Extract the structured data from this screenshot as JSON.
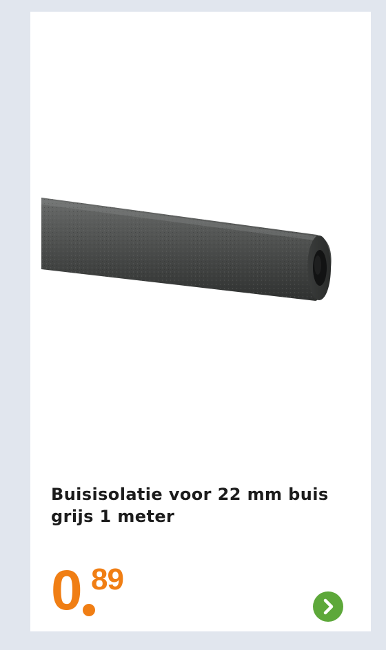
{
  "product": {
    "title": "Buisisolatie voor 22 mm buis grijs 1 meter",
    "image_icon": "pipe-insulation-image"
  },
  "price": {
    "integer": "0",
    "separator": ".",
    "decimals": "89"
  },
  "navigation": {
    "next_icon": "chevron-right-icon"
  },
  "colors": {
    "background": "#e1e6ee",
    "card": "#ffffff",
    "price": "#f07e14",
    "button": "#5da83a",
    "text": "#1c1c1c"
  }
}
